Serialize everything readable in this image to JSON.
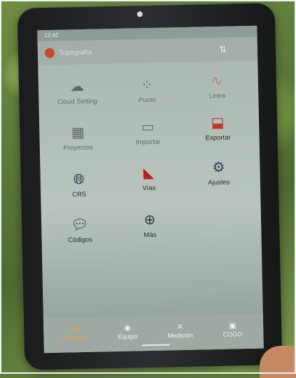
{
  "app": {
    "time": "12:42",
    "name": "Topografía",
    "cloud_action_icon": "cloud-sync-icon"
  },
  "menu": [
    {
      "label": "Cloud Setting",
      "icon": "cloud-setting-icon",
      "color": "#c0392b",
      "faded": true
    },
    {
      "label": "Punto",
      "icon": "point-icon",
      "color": "#9a9a9a",
      "faded": true
    },
    {
      "label": "Linea",
      "icon": "line-icon",
      "color": "#c0392b",
      "faded": true
    },
    {
      "label": "Proyectos",
      "icon": "projects-icon",
      "color": "#c0392b",
      "faded": true
    },
    {
      "label": "Importar",
      "icon": "import-icon",
      "color": "#c0392b",
      "faded": true
    },
    {
      "label": "Exportar",
      "icon": "export-icon",
      "color": "#c0392b",
      "faded": false
    },
    {
      "label": "CRS",
      "icon": "globe-icon",
      "color": "#1f2d3a",
      "faded": false
    },
    {
      "label": "Vías",
      "icon": "road-icon",
      "color": "#b22222",
      "faded": false
    },
    {
      "label": "Ajustes",
      "icon": "gear-icon",
      "color": "#2f3f52",
      "faded": false
    },
    {
      "label": "Códigos",
      "icon": "code-chat-icon",
      "color": "#1f2d3a",
      "faded": false
    },
    {
      "label": "Más",
      "icon": "plus-icon",
      "color": "#2f3a35",
      "faded": false
    }
  ],
  "nav": [
    {
      "label": "Proyecto",
      "icon": "folder-icon",
      "active": true
    },
    {
      "label": "Equipo",
      "icon": "device-icon",
      "active": false
    },
    {
      "label": "Medición",
      "icon": "measure-icon",
      "active": false
    },
    {
      "label": "COGO",
      "icon": "cogo-icon",
      "active": false
    }
  ]
}
